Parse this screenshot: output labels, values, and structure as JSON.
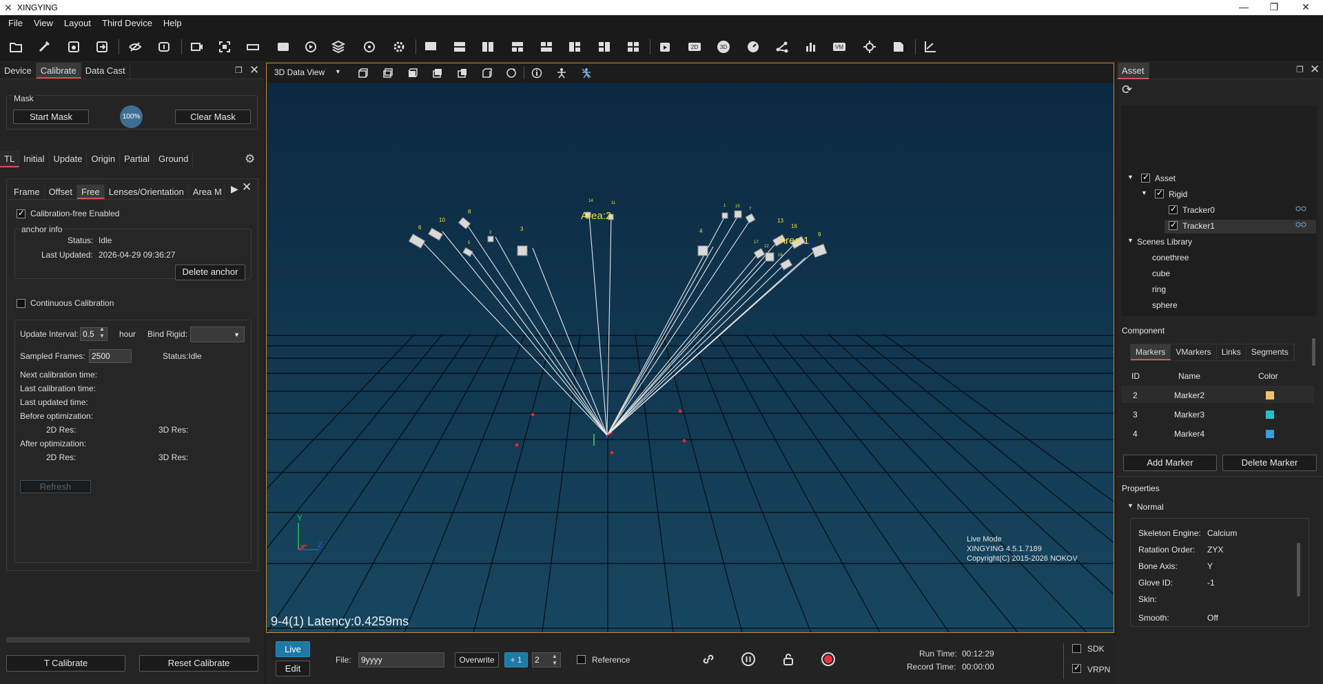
{
  "app": {
    "title": "XINGYING"
  },
  "menu": [
    "File",
    "View",
    "Layout",
    "Third Device",
    "Help"
  ],
  "left": {
    "tabs": [
      "Device",
      "Calibrate",
      "Data Cast"
    ],
    "mask": {
      "title": "Mask",
      "start": "Start Mask",
      "percent": "100%",
      "clear": "Clear Mask"
    },
    "subtabs": [
      "TL",
      "Initial",
      "Update",
      "Origin",
      "Partial",
      "Ground"
    ],
    "innertabs": [
      "Frame",
      "Offset",
      "Free",
      "Lenses/Orientation",
      "Area M"
    ],
    "calib_free": "Calibration-free Enabled",
    "anchor": {
      "title": "anchor info",
      "status_label": "Status:",
      "status": "Idle",
      "updated_label": "Last Updated:",
      "updated": "2026-04-29 09:36:27",
      "delete": "Delete anchor"
    },
    "continuous": "Continuous Calibration",
    "update_interval": {
      "label": "Update Interval:",
      "value": "0.5",
      "unit": "hour"
    },
    "bind_rigid": "Bind Rigid:",
    "sampled": {
      "label": "Sampled Frames:",
      "value": "2500"
    },
    "status": "Status:Idle",
    "next": "Next calibration time:",
    "last": "Last calibration time:",
    "lastupd": "Last updated time:",
    "before": "Before optimization:",
    "after": "After optimization:",
    "res2d": "2D Res:",
    "res3d": "3D Res:",
    "refresh": "Refresh",
    "tcal": "T Calibrate",
    "reset": "Reset Calibrate"
  },
  "view": {
    "mode": "3D Data View",
    "area1": "Area:1",
    "area2": "Area:2",
    "cams": [
      "6",
      "10",
      "8",
      "5",
      "2",
      "3",
      "14",
      "11",
      "4",
      "1",
      "15",
      "7",
      "13",
      "16",
      "17",
      "12",
      "18",
      "9"
    ],
    "live": "Live Mode",
    "ver": "XINGYING 4.5.1.7189",
    "copy": "Copyright(C) 2015-2026 NOKOV",
    "latency": "9-4(1) Latency:0.4259ms",
    "axis": {
      "x": "X",
      "y": "Y",
      "z": "Z"
    }
  },
  "right": {
    "title": "Asset",
    "tree": {
      "asset": "Asset",
      "rigid": "Rigid",
      "t0": "Tracker0",
      "t1": "Tracker1",
      "lib": "Scenes Library",
      "items": [
        "conethree",
        "cube",
        "ring",
        "sphere"
      ]
    },
    "component": "Component",
    "ctabs": [
      "Markers",
      "VMarkers",
      "Links",
      "Segments"
    ],
    "cols": [
      "ID",
      "Name",
      "Color"
    ],
    "markers": [
      {
        "id": "2",
        "name": "Marker2",
        "color": "#f2c26b"
      },
      {
        "id": "3",
        "name": "Marker3",
        "color": "#26c0c9"
      },
      {
        "id": "4",
        "name": "Marker4",
        "color": "#3a9ee0"
      }
    ],
    "add": "Add Marker",
    "del": "Delete Marker",
    "props": "Properties",
    "normal": "Normal",
    "prop_rows": [
      [
        "Skeleton Engine:",
        "Calcium"
      ],
      [
        "Ratation Order:",
        "ZYX"
      ],
      [
        "Bone Axis:",
        "Y"
      ],
      [
        "Glove ID:",
        "-1"
      ],
      [
        "Skin:",
        ""
      ],
      [
        "Smooth:",
        "Off"
      ]
    ]
  },
  "bottom": {
    "live": "Live",
    "edit": "Edit",
    "file_label": "File:",
    "file": "9yyyy",
    "overwrite": "Overwrite",
    "plus": "+ 1",
    "num": "2",
    "reference": "Reference",
    "run_label": "Run Time:",
    "run": "00:12:29",
    "rec_label": "Record Time:",
    "rec": "00:00:00",
    "sdk": "SDK",
    "vrpn": "VRPN"
  }
}
